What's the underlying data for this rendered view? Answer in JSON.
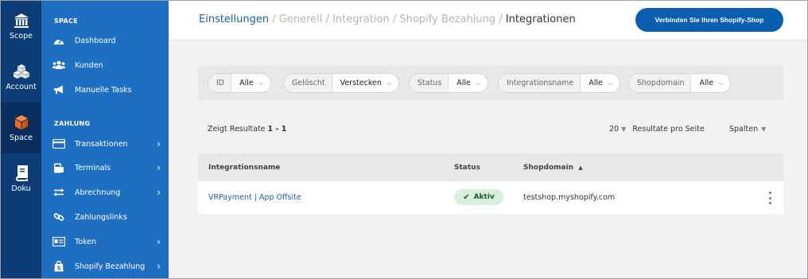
{
  "rail": {
    "items": [
      {
        "label": "Scope",
        "icon": "bank-icon"
      },
      {
        "label": "Account",
        "icon": "cubes-icon"
      },
      {
        "label": "Space",
        "icon": "cube-icon",
        "active": true
      },
      {
        "label": "Doku",
        "icon": "book-icon"
      }
    ]
  },
  "sidebar": {
    "section_space": "SPACE",
    "section_payment": "ZAHLUNG",
    "items": [
      {
        "label": "Dashboard"
      },
      {
        "label": "Kunden"
      },
      {
        "label": "Manuelle Tasks"
      },
      {
        "label": "Transaktionen",
        "chevron": "›"
      },
      {
        "label": "Terminals",
        "chevron": "›"
      },
      {
        "label": "Abrechnung",
        "chevron": "›"
      },
      {
        "label": "Zahlungslinks"
      },
      {
        "label": "Token",
        "chevron": "›"
      },
      {
        "label": "Shopify Bezahlung",
        "chevron": "›"
      }
    ]
  },
  "header": {
    "breadcrumb": [
      {
        "label": "Einstellungen"
      },
      {
        "label": "Generell"
      },
      {
        "label": "Integration"
      },
      {
        "label": "Shopify Bezahlung"
      },
      {
        "label": "Integrationen"
      }
    ],
    "separator": "/",
    "connect_button": "Verbinden Sie Ihren Shopify-Shop"
  },
  "filters": [
    {
      "label": "ID",
      "value": "Alle"
    },
    {
      "label": "Gelöscht",
      "value": "Verstecken"
    },
    {
      "label": "Status",
      "value": "Alle"
    },
    {
      "label": "Integrationsname",
      "value": "Alle"
    },
    {
      "label": "Shopdomain",
      "value": "Alle"
    }
  ],
  "results": {
    "prefix": "Zeigt Resultate ",
    "range": "1 - 1",
    "per_page_value": "20",
    "per_page_label": "Resultate pro Seite",
    "columns_label": "Spalten"
  },
  "table": {
    "headers": {
      "name": "Integrationsname",
      "status": "Status",
      "shopdomain": "Shopdomain",
      "sort_indicator": "▲"
    },
    "rows": [
      {
        "name": "VRPayment | App Offsite",
        "status": "Aktiv",
        "shopdomain": "testshop.myshopify.com"
      }
    ]
  },
  "colors": {
    "rail": "#0c3d77",
    "sidebar": "#1e6fc2",
    "accent": "#0b5fb0",
    "link": "#1c5ea8",
    "status_active_bg": "#d6f0dc",
    "status_active_fg": "#1d5a2c",
    "space_icon": "#f26a21"
  }
}
